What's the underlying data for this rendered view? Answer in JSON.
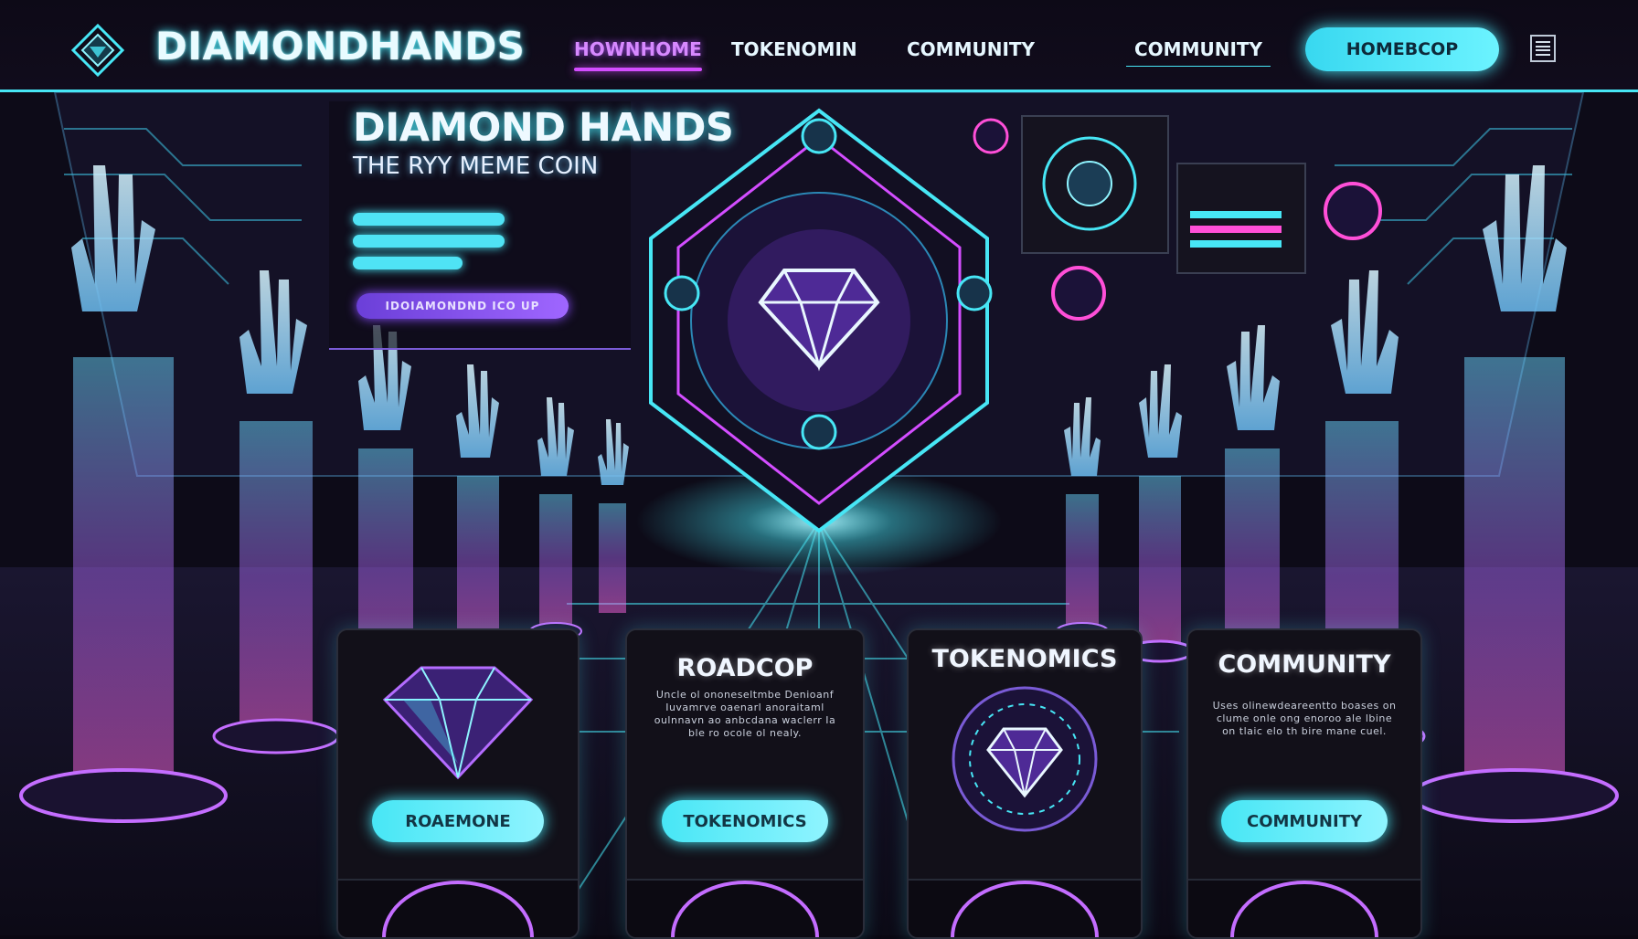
{
  "brand": {
    "name": "DIAMONDHANDS"
  },
  "nav": {
    "links": [
      {
        "label": "HOWNHOME",
        "active": true
      },
      {
        "label": "TOKENOMIN",
        "active": false
      },
      {
        "label": "COMMUNITY",
        "active": false
      }
    ],
    "outlined_link": "COMMUNITY",
    "cta_label": "HOMEBCOP",
    "menu_icon": "hamburger-menu-icon"
  },
  "hero": {
    "title": "DIAMOND HANDS",
    "subtitle": "THE RYY MEME COIN",
    "button_label": "IDOIAMONDND  ICO UP",
    "center_icon": "diamond-icon"
  },
  "cards": [
    {
      "title": "",
      "icon": "diamond-icon",
      "text": "",
      "button_label": "ROAEMONE"
    },
    {
      "title": "ROADCOP",
      "icon": "",
      "text": "Uncle ol ononeseltmbe Denioanf Iuvamrve oaenarl anoraitaml oulnnavn ao anbcdana waclerr Ia ble ro ocole ol nealy.",
      "button_label": "TOKENOMICS"
    },
    {
      "title": "TOKENOMICS",
      "icon": "diamond-icon",
      "text": "",
      "button_label": ""
    },
    {
      "title": "COMMUNITY",
      "icon": "",
      "text": "Uses olinewdeareentto boases on clume onle ong enoroo ale lbine on tlaic elo th bire mane cuel.",
      "button_label": "COMMUNITY"
    }
  ],
  "colors": {
    "accent_cyan": "#47e6f5",
    "accent_magenta": "#d34dff",
    "accent_purple": "#8a4dff",
    "background": "#0a0712"
  }
}
